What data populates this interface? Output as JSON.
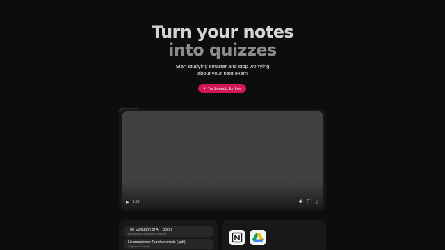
{
  "hero": {
    "title_line1": "Turn your notes",
    "title_line2": "into quizzes",
    "subtitle_line1": "Start studying smarter and stop worrying",
    "subtitle_line2": "about your next exam"
  },
  "cta": {
    "icon": "sparkle-icon",
    "label": "Try Zenquiz for free"
  },
  "video": {
    "current_time": "0:00",
    "icons": [
      "play-icon",
      "volume-icon",
      "fullscreen-icon",
      "more-options-icon"
    ]
  },
  "files": [
    {
      "title": "The Evolution of AI (.docx)",
      "subtitle": "Introduction to Machine Learning"
    },
    {
      "title": "Neuroscience Fundamentals (.pdf)",
      "subtitle": "Cognitive Sciences"
    }
  ],
  "integrations": [
    "notion-icon",
    "google-drive-icon"
  ],
  "colors": {
    "background": "#0d0d0e",
    "accent": "#d1165a",
    "card": "#181819",
    "video": "#414141"
  }
}
